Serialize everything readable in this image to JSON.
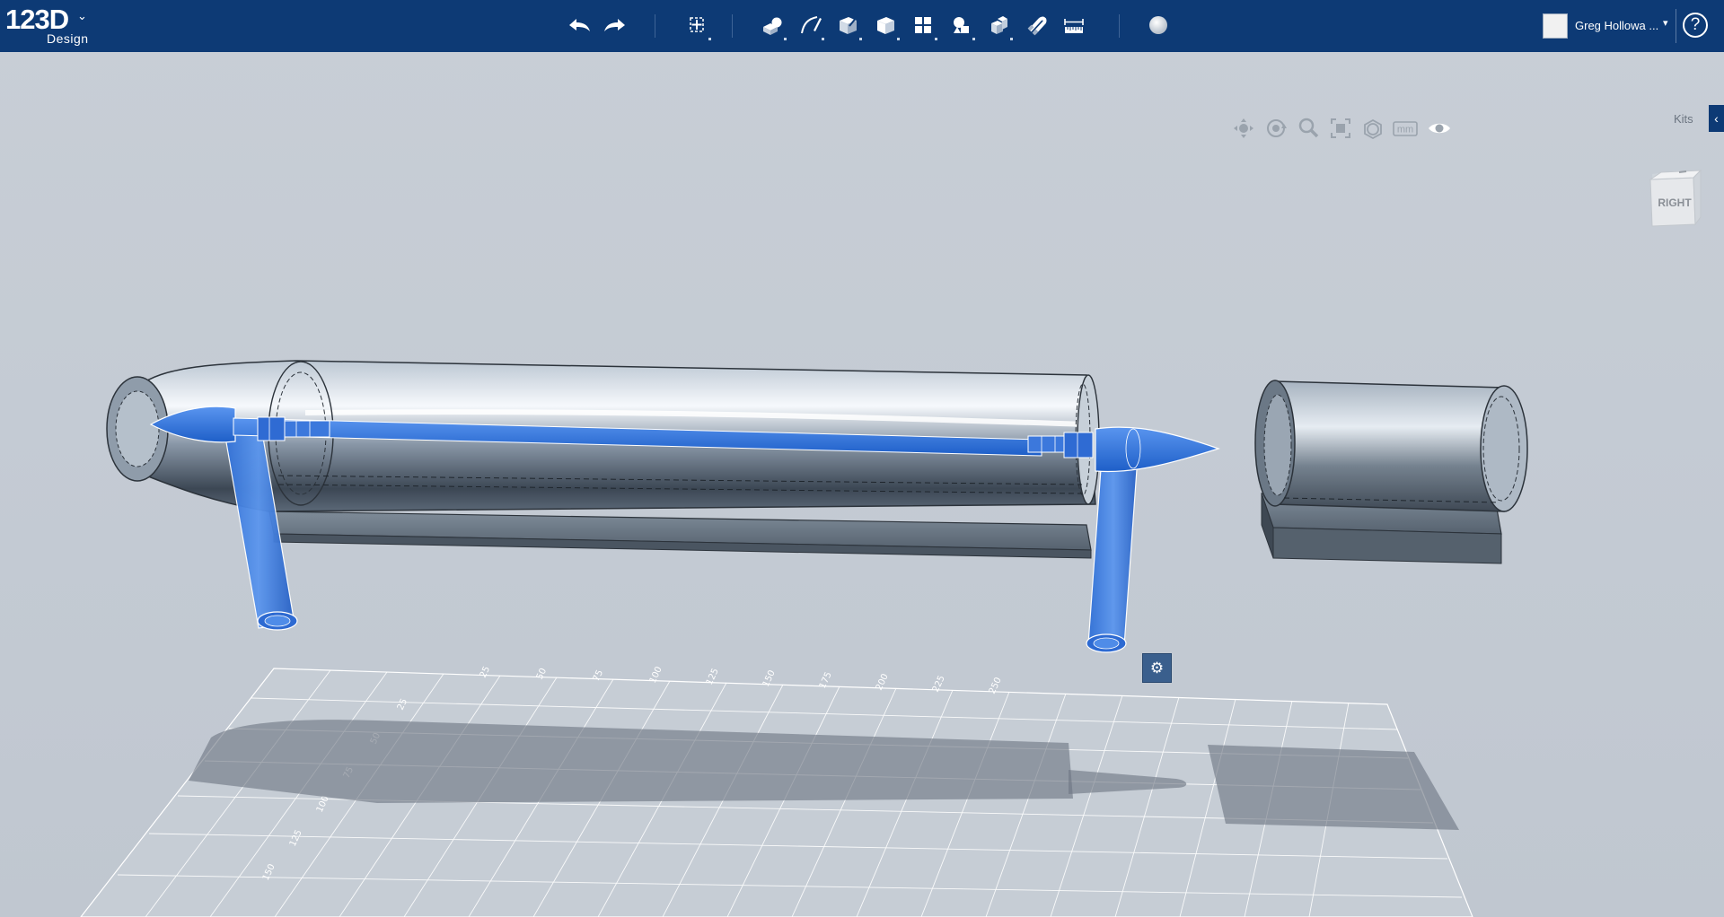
{
  "app": {
    "logo_main": "123D",
    "logo_sub": "Design",
    "logo_chevron": "⌄"
  },
  "toolbar": {
    "icons": [
      "undo-icon",
      "redo-icon",
      "transform-icon",
      "primitives-icon",
      "sketch-icon",
      "construct-icon",
      "modify-icon",
      "pattern-icon",
      "grouping-icon",
      "combine-icon",
      "snap-icon",
      "measure-icon",
      "material-icon"
    ]
  },
  "user": {
    "name": "Greg Hollowa ...",
    "caret": "▾",
    "help": "?"
  },
  "view_tools": {
    "icons": [
      "pan-icon",
      "orbit-icon",
      "zoom-icon",
      "fit-icon",
      "materials-outlines-icon",
      "units-icon",
      "visibility-icon"
    ],
    "units_label": "mm"
  },
  "kits": {
    "label": "Kits",
    "toggle": "‹"
  },
  "view_cube": {
    "face_label": "RIGHT"
  },
  "gear": {
    "icon": "⚙"
  },
  "grid": {
    "top_labels": [
      "25",
      "50",
      "75",
      "100",
      "125",
      "150",
      "175",
      "200",
      "225",
      "250"
    ],
    "side_labels": [
      "25",
      "50",
      "75",
      "100",
      "125",
      "150"
    ]
  },
  "colors": {
    "topbar": "#0d3a75",
    "selection_blue": "#2a6fd8",
    "part_gray": "#6f7e8f"
  }
}
